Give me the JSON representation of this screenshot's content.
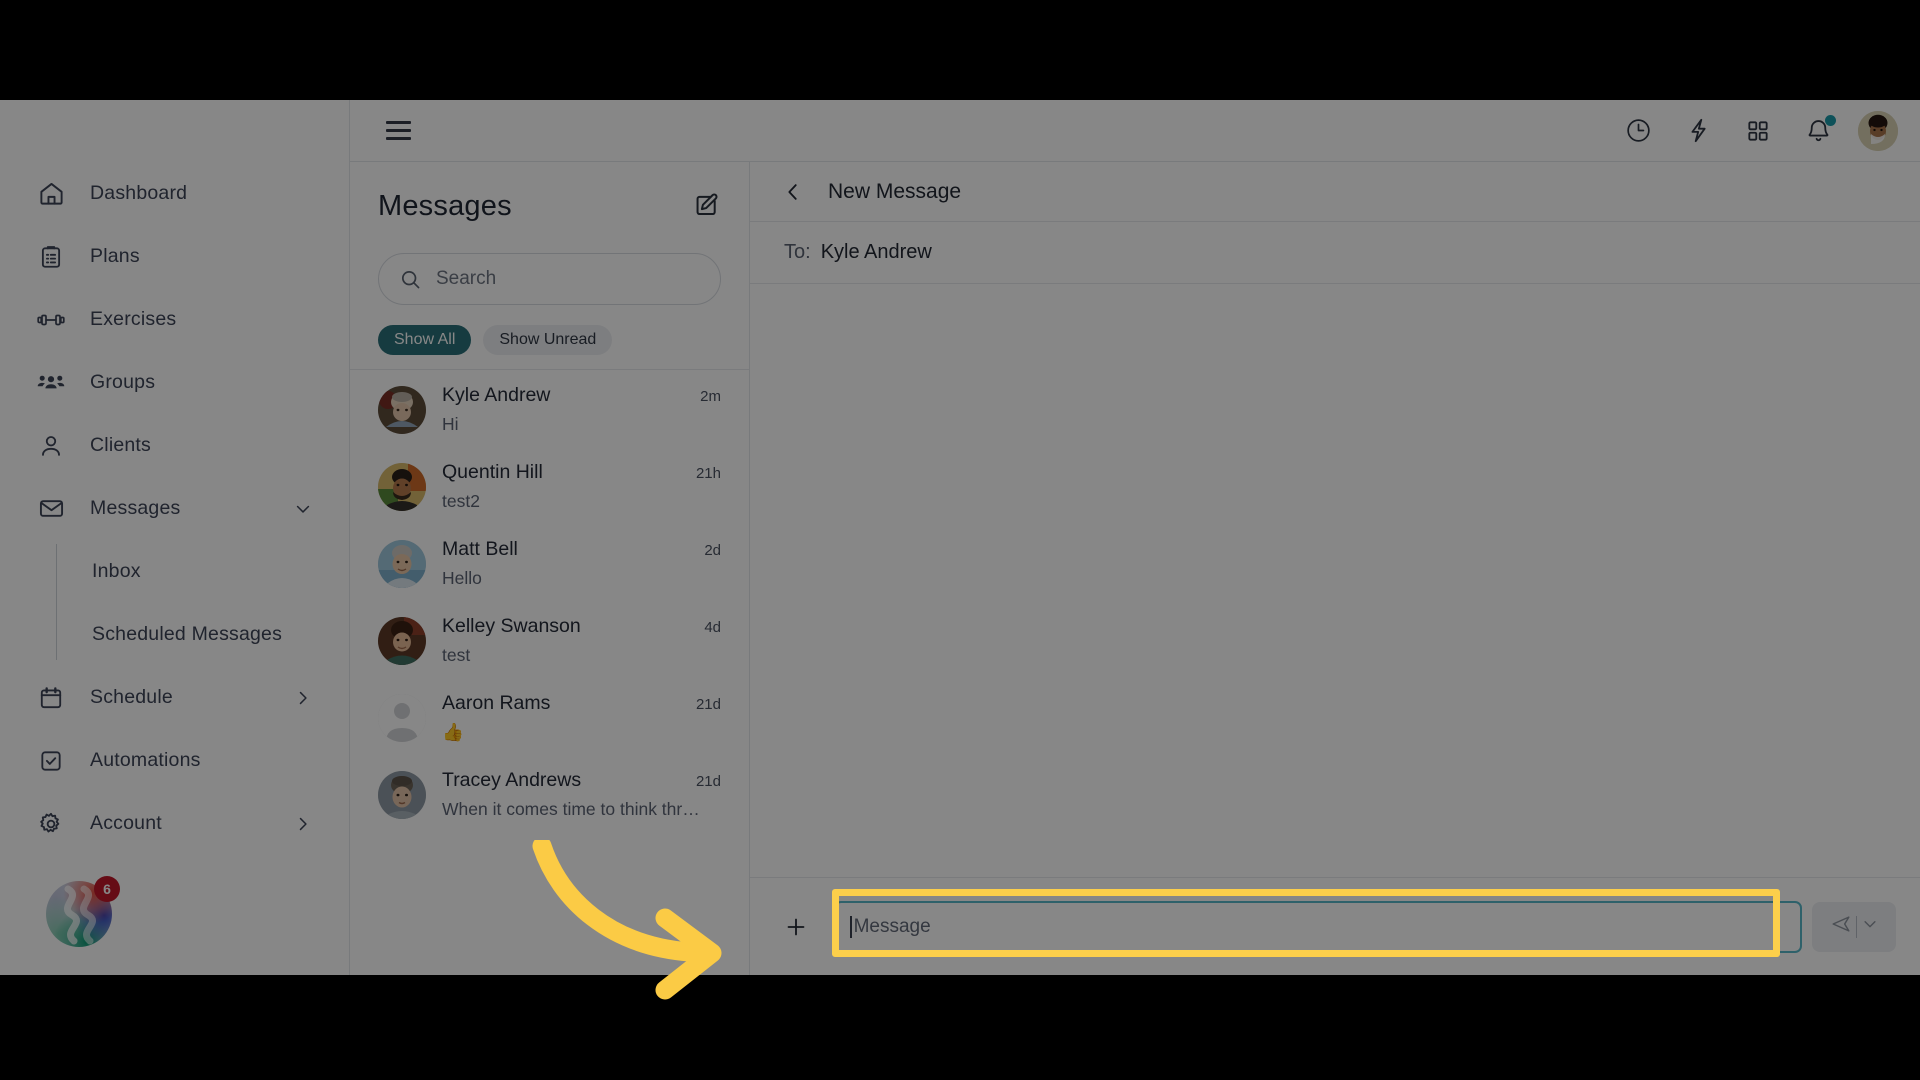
{
  "sidebar": {
    "items": [
      {
        "label": "Dashboard",
        "icon": "home-icon",
        "chevron": ""
      },
      {
        "label": "Plans",
        "icon": "clipboard-icon",
        "chevron": ""
      },
      {
        "label": "Exercises",
        "icon": "dumbbell-icon",
        "chevron": ""
      },
      {
        "label": "Groups",
        "icon": "people-icon",
        "chevron": ""
      },
      {
        "label": "Clients",
        "icon": "person-icon",
        "chevron": ""
      },
      {
        "label": "Messages",
        "icon": "envelope-icon",
        "chevron": "down"
      }
    ],
    "sub_items": [
      {
        "label": "Inbox"
      },
      {
        "label": "Scheduled Messages"
      }
    ],
    "items_after": [
      {
        "label": "Schedule",
        "icon": "calendar-icon",
        "chevron": "right"
      },
      {
        "label": "Automations",
        "icon": "checkbox-icon",
        "chevron": ""
      },
      {
        "label": "Account",
        "icon": "gear-icon",
        "chevron": "right"
      }
    ],
    "brand_badge_count": "6"
  },
  "topbar": {
    "menu_icon": "hamburger-icon",
    "icons": [
      "clock-icon",
      "lightning-icon",
      "grid-icon",
      "bell-icon"
    ],
    "avatar": "user-avatar"
  },
  "messages_panel": {
    "title": "Messages",
    "compose_icon": "compose-icon",
    "search": {
      "placeholder": "Search",
      "value": "",
      "icon": "search-icon"
    },
    "filters": [
      {
        "label": "Show All",
        "active": true
      },
      {
        "label": "Show Unread",
        "active": false
      }
    ],
    "conversations": [
      {
        "name": "Kyle Andrew",
        "preview": "Hi",
        "time": "2m",
        "avatar_tone": "#6d5b4a",
        "has_photo": true
      },
      {
        "name": "Quentin Hill",
        "preview": "test2",
        "time": "21h",
        "avatar_tone": "#8a6a3e",
        "has_photo": true
      },
      {
        "name": "Matt Bell",
        "preview": "Hello",
        "time": "2d",
        "avatar_tone": "#7fb5cf",
        "has_photo": true
      },
      {
        "name": "Kelley Swanson",
        "preview": "test",
        "time": "4d",
        "avatar_tone": "#6b4436",
        "has_photo": true
      },
      {
        "name": "Aaron Rams",
        "preview": "👍",
        "time": "21d",
        "avatar_tone": "#d5d7da",
        "has_photo": false
      },
      {
        "name": "Tracey Andrews",
        "preview": "When it comes time to think thr…",
        "time": "21d",
        "avatar_tone": "#9a8e86",
        "has_photo": true
      }
    ]
  },
  "thread": {
    "back_icon": "chevron-left-icon",
    "title": "New Message",
    "to_label": "To:",
    "to_value": "Kyle Andrew",
    "composer": {
      "plus_icon": "plus-icon",
      "message_placeholder": "Message",
      "message_value": "",
      "send_icon": "send-icon",
      "dropdown_icon": "chevron-down-icon"
    }
  },
  "annotation": {
    "highlight_color": "#FCCF4B",
    "arrow_color": "#FBCB45",
    "shape": "curved-arrow-pointing-right"
  },
  "colors": {
    "accent_teal": "#2b7079",
    "focus_border": "#58b7c9",
    "badge_red": "#c0182b",
    "notification_dot": "#1c9aa8",
    "text_primary": "#242b38",
    "text_secondary": "#5b6373"
  }
}
